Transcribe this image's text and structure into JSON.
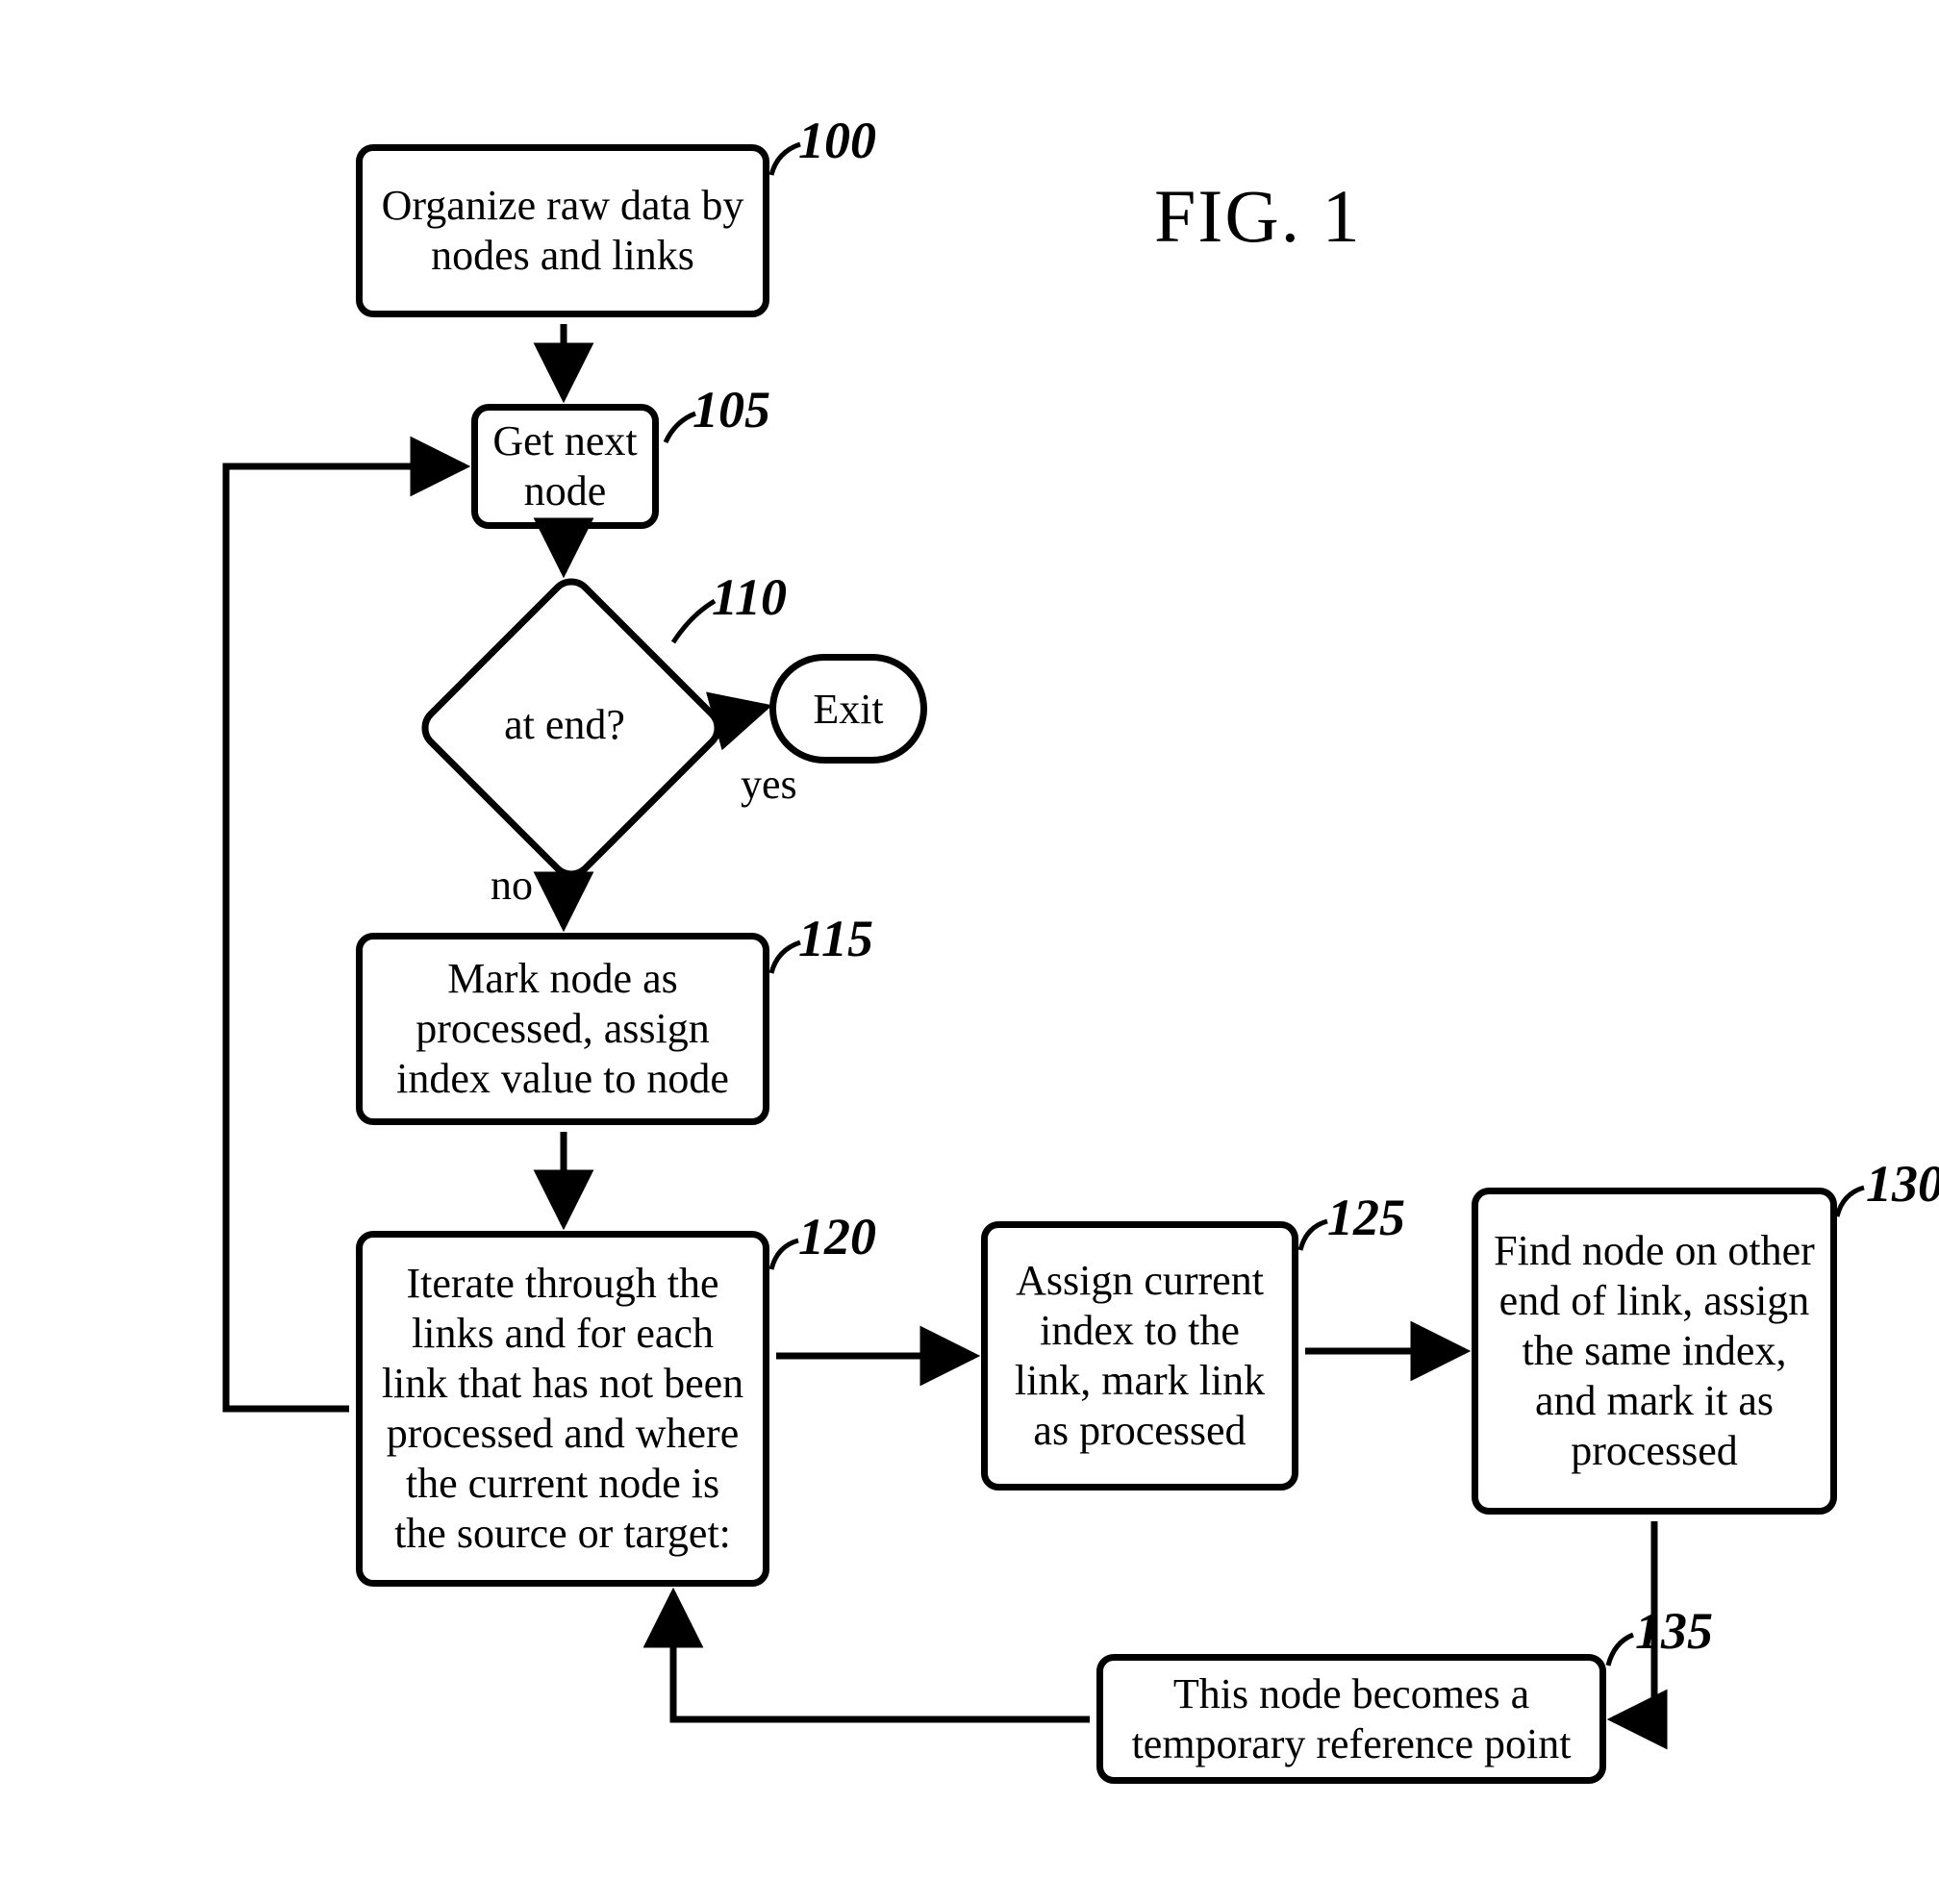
{
  "title": "FIG. 1",
  "nodes": {
    "n100": {
      "ref": "100",
      "text": "Organize raw data by nodes and links"
    },
    "n105": {
      "ref": "105",
      "text": "Get next node"
    },
    "n110": {
      "ref": "110",
      "text": "at end?",
      "yes": "yes",
      "no": "no"
    },
    "exit": {
      "text": "Exit"
    },
    "n115": {
      "ref": "115",
      "text": "Mark node as processed, assign index value to node"
    },
    "n120": {
      "ref": "120",
      "text": "Iterate through the links and for each link that has not been processed and where the current node is the source or target:"
    },
    "n125": {
      "ref": "125",
      "text": "Assign current index to the link, mark link as processed"
    },
    "n130": {
      "ref": "130",
      "text": "Find node on other end of link, assign the same index, and mark it as processed"
    },
    "n135": {
      "ref": "135",
      "text": "This node becomes a temporary reference point"
    }
  }
}
